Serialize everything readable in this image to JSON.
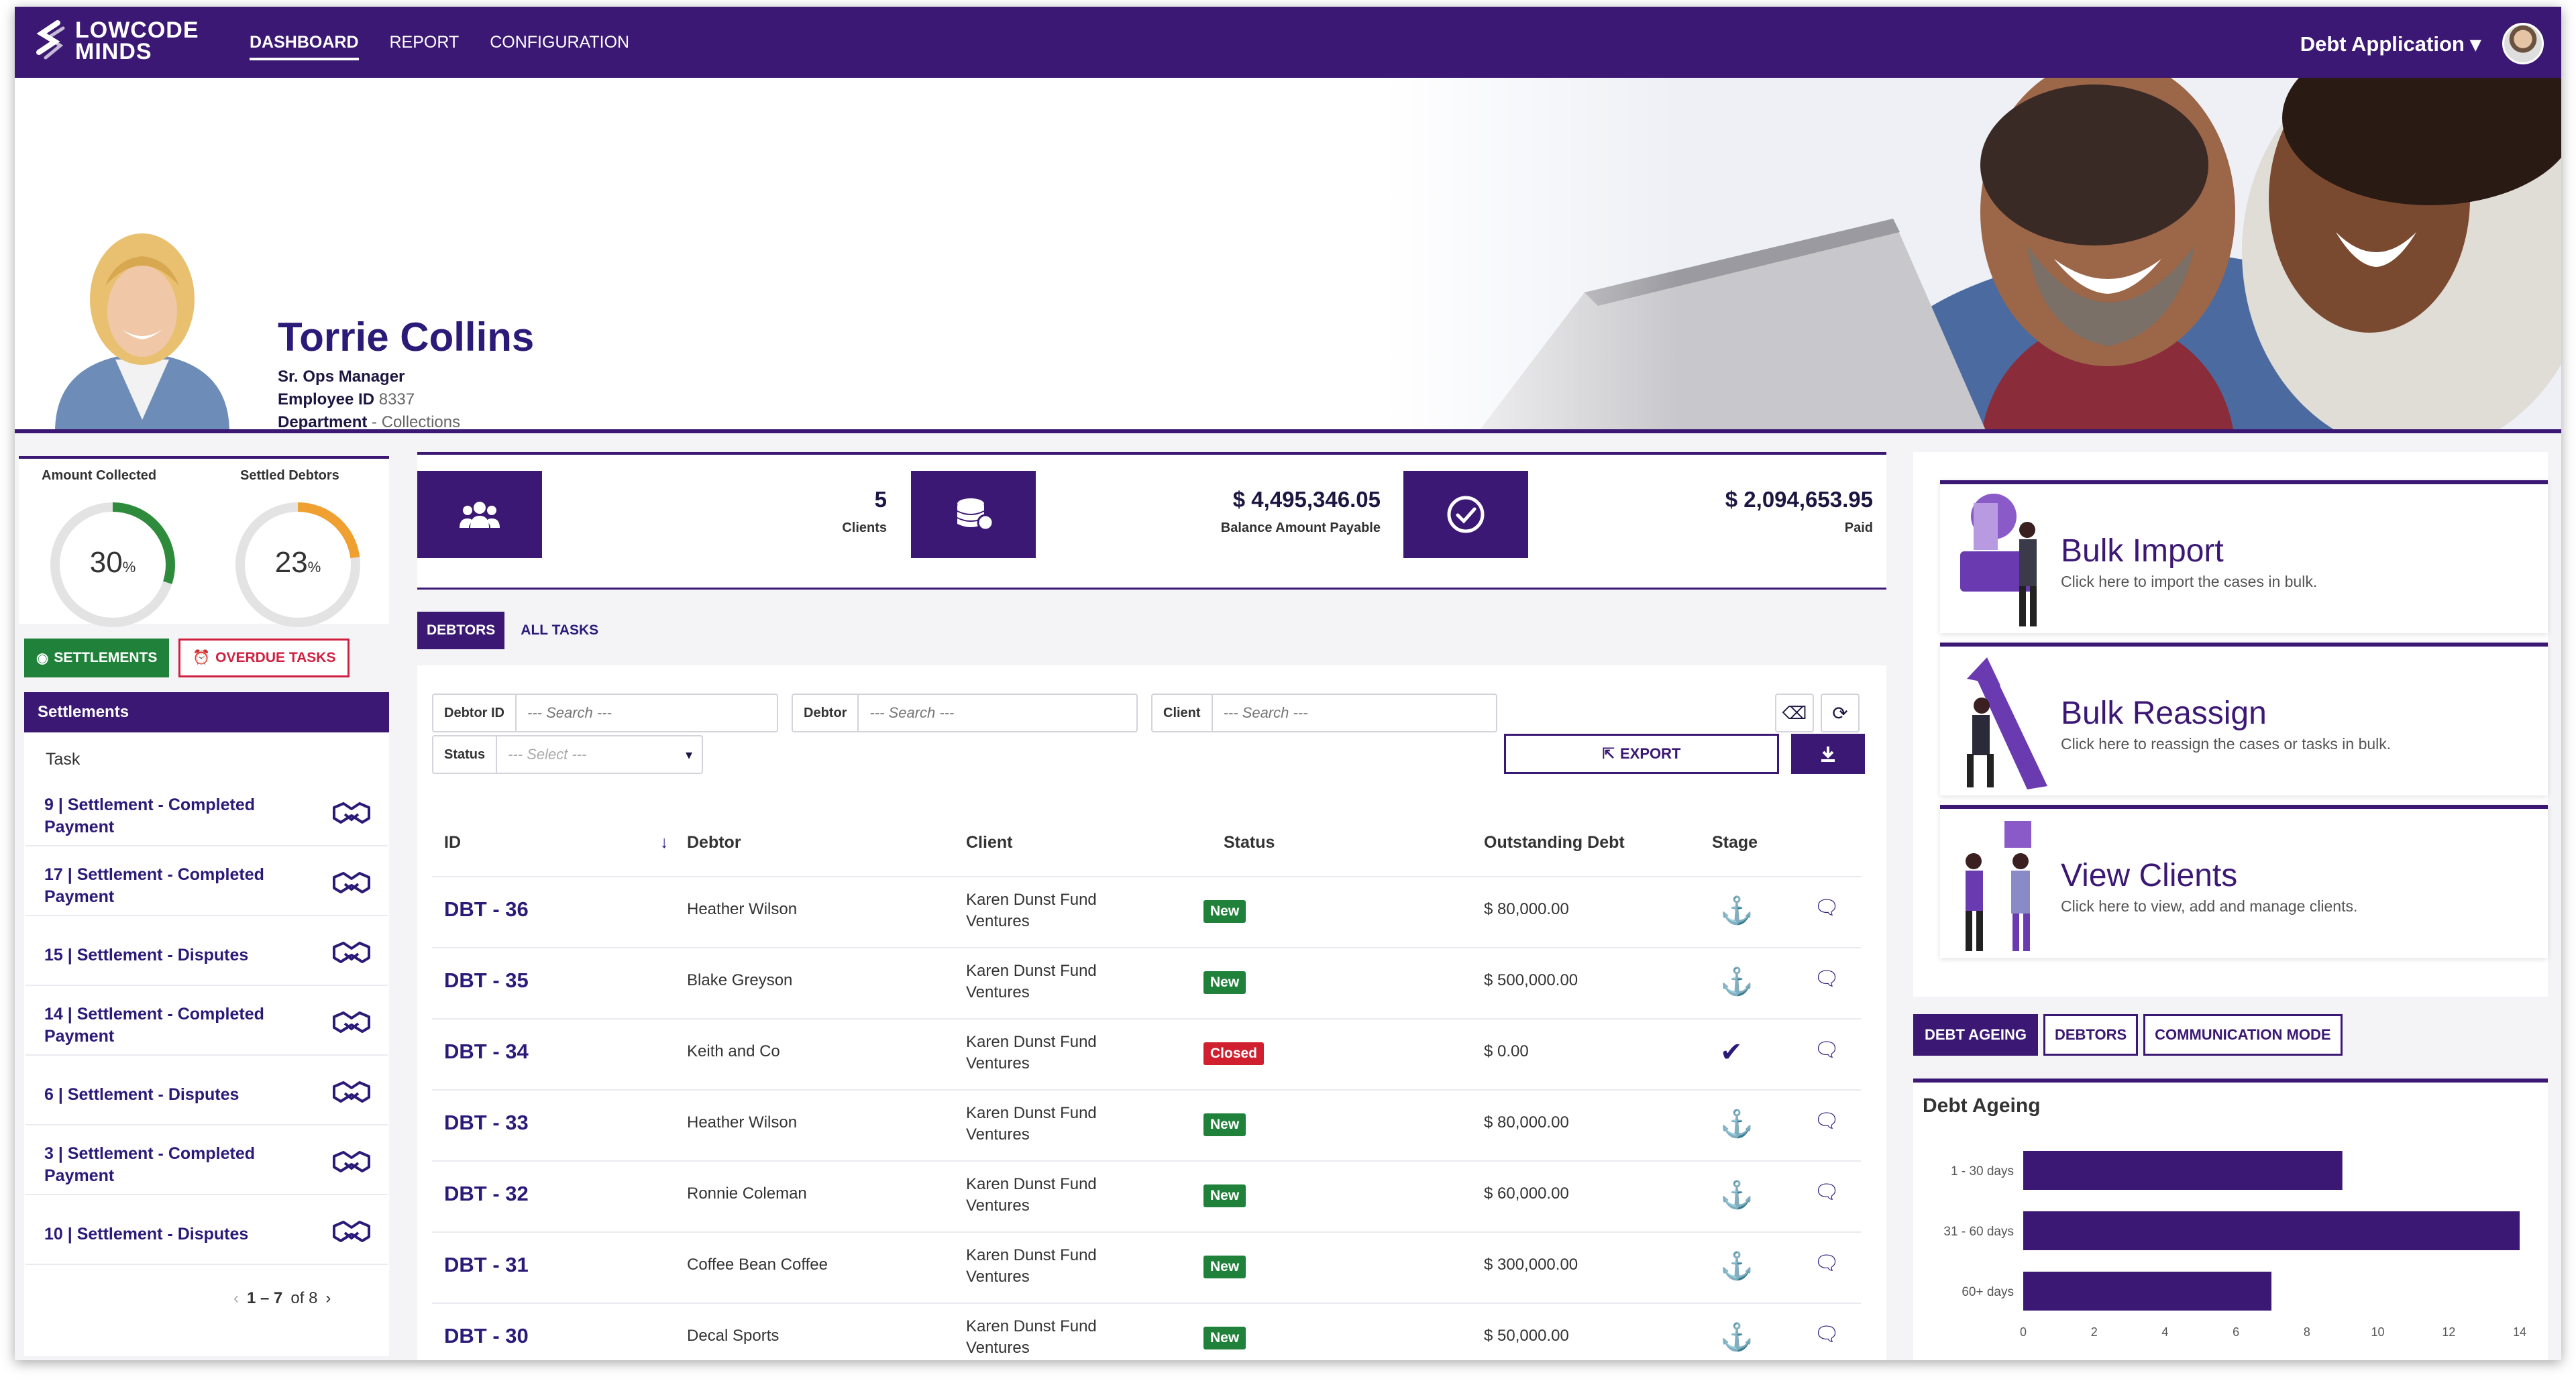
{
  "app": {
    "logo_line1": "LOWCODE",
    "logo_line2": "MINDS",
    "nav": [
      "DASHBOARD",
      "REPORT",
      "CONFIGURATION"
    ],
    "app_menu": "Debt Application"
  },
  "profile": {
    "name": "Torrie Collins",
    "title": "Sr. Ops Manager",
    "employee_label": "Employee ID",
    "employee_id": "8337",
    "department_label": "Department",
    "department": "Collections"
  },
  "stats": {
    "amount_label": "Amount Collected",
    "amount_value": "30",
    "amount_fraction": 0.3,
    "settled_label": "Settled Debtors",
    "settled_value": "23",
    "settled_fraction": 0.23,
    "percent_sign": "%",
    "amount_color": "#2e8b3c",
    "settled_color": "#f0a030"
  },
  "left": {
    "settlements_btn": "SETTLEMENTS",
    "overdue_btn": "OVERDUE TASKS",
    "panel_title": "Settlements",
    "task_header": "Task",
    "tasks": [
      {
        "line1": "9 | Settlement - Completed",
        "line2": "Payment"
      },
      {
        "line1": "17 | Settlement - Completed",
        "line2": "Payment"
      },
      {
        "line1": "15 | Settlement - Disputes",
        "line2": ""
      },
      {
        "line1": "14 | Settlement - Completed",
        "line2": "Payment"
      },
      {
        "line1": "6 | Settlement - Disputes",
        "line2": ""
      },
      {
        "line1": "3 | Settlement - Completed",
        "line2": "Payment"
      },
      {
        "line1": "10 | Settlement - Disputes",
        "line2": ""
      }
    ],
    "pager_range": "1 – 7",
    "pager_of": "of 8"
  },
  "kpis": [
    {
      "value": "5",
      "label": "Clients",
      "icon": "users-icon"
    },
    {
      "value": "$ 4,495,346.05",
      "label": "Balance Amount Payable",
      "icon": "coins-icon"
    },
    {
      "value": "$ 2,094,653.95",
      "label": "Paid",
      "icon": "check-circle-icon"
    }
  ],
  "tabs": {
    "debtors": "DEBTORS",
    "all_tasks": "ALL TASKS"
  },
  "filters": {
    "debtor_id_label": "Debtor ID",
    "debtor_label": "Debtor",
    "client_label": "Client",
    "status_label": "Status",
    "search_placeholder": "--- Search ---",
    "select_placeholder": "--- Select ---",
    "export_label": "EXPORT"
  },
  "table": {
    "headers": [
      "ID",
      "Debtor",
      "Client",
      "Status",
      "Outstanding Debt",
      "Stage"
    ],
    "rows": [
      {
        "id": "DBT - 36",
        "debtor": "Heather Wilson",
        "client1": "Karen Dunst Fund",
        "client2": "Ventures",
        "status": "New",
        "debt": "$ 80,000.00",
        "stage": "anchor"
      },
      {
        "id": "DBT - 35",
        "debtor": "Blake Greyson",
        "client1": "Karen Dunst Fund",
        "client2": "Ventures",
        "status": "New",
        "debt": "$ 500,000.00",
        "stage": "anchor"
      },
      {
        "id": "DBT - 34",
        "debtor": "Keith and Co",
        "client1": "Karen Dunst Fund",
        "client2": "Ventures",
        "status": "Closed",
        "debt": "$ 0.00",
        "stage": "check"
      },
      {
        "id": "DBT - 33",
        "debtor": "Heather Wilson",
        "client1": "Karen Dunst Fund",
        "client2": "Ventures",
        "status": "New",
        "debt": "$ 80,000.00",
        "stage": "anchor"
      },
      {
        "id": "DBT - 32",
        "debtor": "Ronnie Coleman",
        "client1": "Karen Dunst Fund",
        "client2": "Ventures",
        "status": "New",
        "debt": "$ 60,000.00",
        "stage": "anchor"
      },
      {
        "id": "DBT - 31",
        "debtor": "Coffee Bean Coffee",
        "client1": "Karen Dunst Fund",
        "client2": "Ventures",
        "status": "New",
        "debt": "$ 300,000.00",
        "stage": "anchor"
      },
      {
        "id": "DBT - 30",
        "debtor": "Decal Sports",
        "client1": "Karen Dunst Fund",
        "client2": "Ventures",
        "status": "New",
        "debt": "$ 50,000.00",
        "stage": "anchor"
      }
    ],
    "status_colors": {
      "New": "#20823a",
      "Closed": "#d02030"
    }
  },
  "actions": [
    {
      "title": "Bulk Import",
      "subtitle": "Click here to import the cases in bulk."
    },
    {
      "title": "Bulk Reassign",
      "subtitle": "Click here to reassign the cases or tasks in bulk."
    },
    {
      "title": "View Clients",
      "subtitle": "Click here to view, add and manage clients."
    }
  ],
  "right_tabs": [
    "DEBT AGEING",
    "DEBTORS",
    "COMMUNICATION MODE"
  ],
  "chart_data": {
    "type": "bar",
    "orientation": "horizontal",
    "title": "Debt Ageing",
    "categories": [
      "1 - 30 days",
      "31 - 60 days",
      "60+ days"
    ],
    "values": [
      9,
      14,
      7
    ],
    "xlim": [
      0,
      14
    ],
    "xticks": [
      0,
      2,
      4,
      6,
      8,
      10,
      12,
      14
    ],
    "color": "#3b1873",
    "grid": false
  }
}
